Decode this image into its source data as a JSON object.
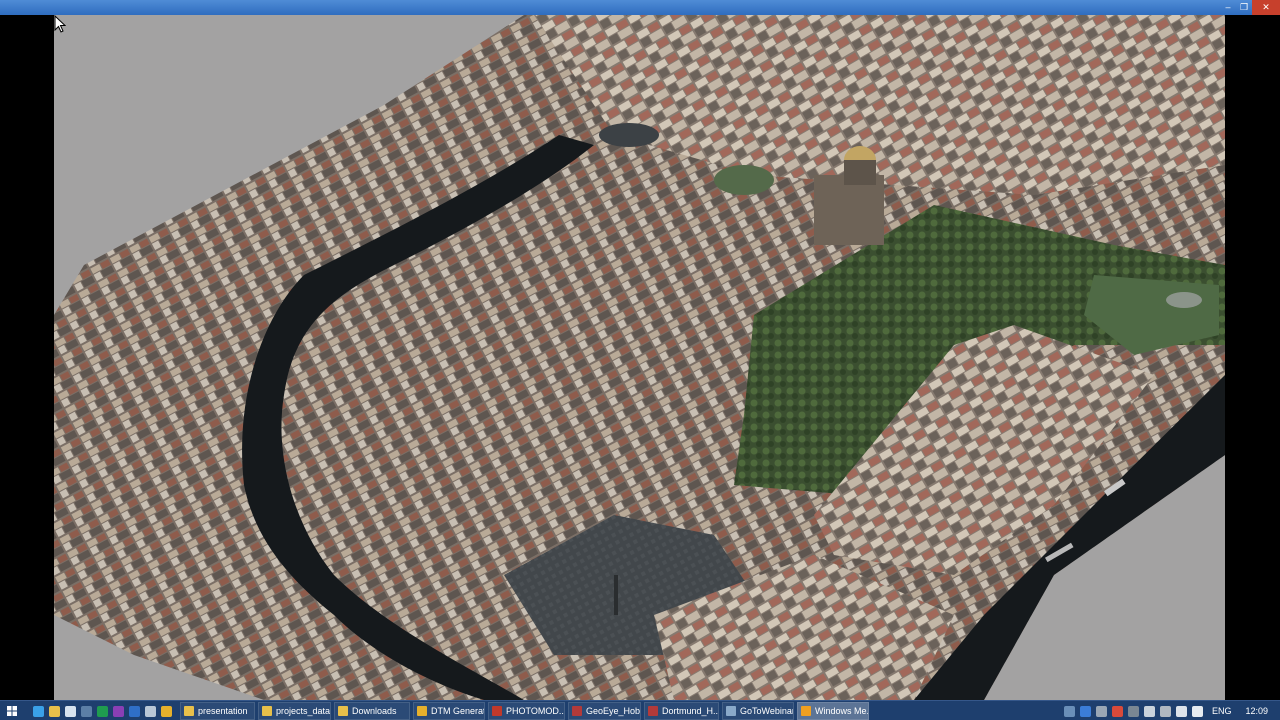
{
  "window": {
    "controls": {
      "minimize": "–",
      "restore": "❐",
      "close": "✕"
    }
  },
  "viewer": {
    "content": "3D textured city model (aerial oblique)",
    "colors": {
      "background": "#a3a2a2",
      "river": "#15191c",
      "park": "#3f5634",
      "square": "#3c4145"
    }
  },
  "taskbar": {
    "pinned_icons": [
      "ie-icon",
      "folder-icon",
      "notepad-icon",
      "calc-icon",
      "excel-icon",
      "onenote-icon",
      "outlook-icon",
      "paint-icon",
      "chrome-icon"
    ],
    "tasks": [
      {
        "label": "presentation",
        "icon": "folder-icon",
        "active": false
      },
      {
        "label": "projects_data",
        "icon": "folder-icon",
        "active": false
      },
      {
        "label": "Downloads",
        "icon": "folder-icon",
        "active": false
      },
      {
        "label": "DTM Generati...",
        "icon": "chrome-icon",
        "active": false
      },
      {
        "label": "PHOTOMOD...",
        "icon": "pdf-icon",
        "active": false
      },
      {
        "label": "GeoEye_Hob...",
        "icon": "app-icon",
        "active": false
      },
      {
        "label": "Dortmund_H...",
        "icon": "app-icon",
        "active": false
      },
      {
        "label": "GoToWebinar",
        "icon": "gear-icon",
        "active": false
      },
      {
        "label": "Windows Me...",
        "icon": "media-player-icon",
        "active": true
      }
    ],
    "tray": {
      "language": "ENG",
      "clock": "12:09"
    }
  }
}
